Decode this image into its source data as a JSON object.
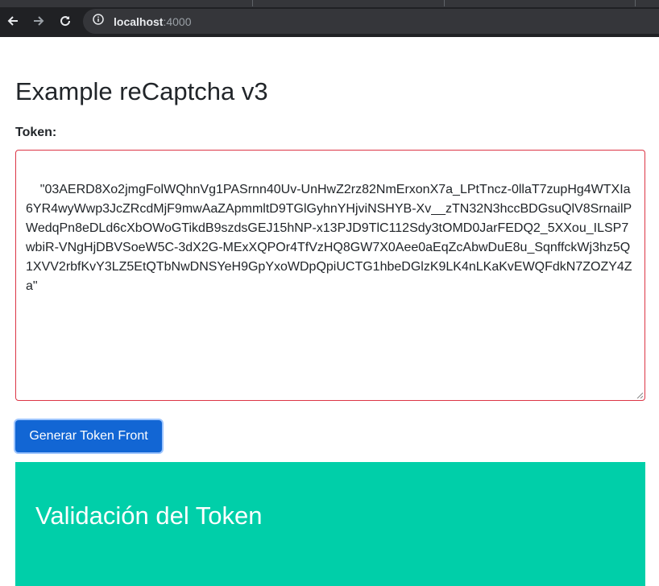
{
  "browser": {
    "url_host": "localhost",
    "url_port": ":4000",
    "icons": [
      "back-arrow-icon",
      "forward-arrow-icon",
      "reload-icon",
      "site-info-icon"
    ]
  },
  "page": {
    "title": "Example reCaptcha v3",
    "token_label": "Token:",
    "token_value": "\"03AERD8Xo2jmgFolWQhnVg1PASrnn40Uv-UnHwZ2rz82NmErxonX7a_LPtTncz-0llaT7zupHg4WTXIa6YR4wyWwp3JcZRcdMjF9mwAaZApmmltD9TGlGyhnYHjviNSHYB-Xv__zTN32N3hccBDGsuQlV8SrnailPWedqPn8eDLd6cXbOWoGTikdB9szdsGEJ15hNP-x13PJD9TlC112Sdy3tOMD0JarFEDQ2_5XXou_ILSP7wbiR-VNgHjDBVSoeW5C-3dX2G-MExXQPOr4TfVzHQ8GW7X0Aee0aEqZcAbwDuE8u_SqnffckWj3hz5Q1XVV2rbfKvY3LZ5EtQTbNwDNSYeH9GpYxoWDpQpiUCTG1hbeDGlzK9LK4nLKaKvEWQFdkN7ZOZY4Za\"",
    "generate_button": "Generar Token Front",
    "validation_title": "Validación del Token"
  },
  "colors": {
    "browser_bg": "#202124",
    "textarea_border": "#dc3545",
    "button_bg": "#1266d4",
    "panel_bg": "#00cfa9"
  }
}
